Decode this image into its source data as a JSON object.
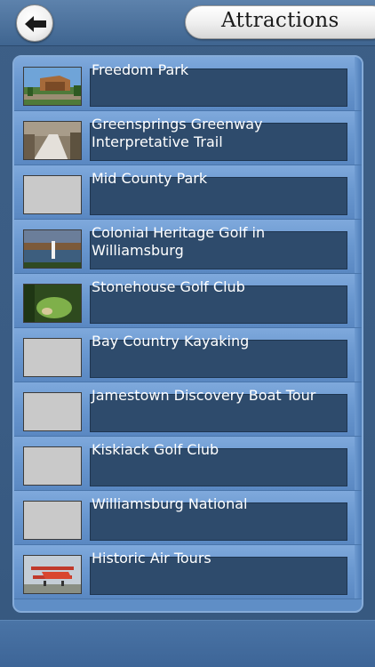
{
  "header": {
    "title": "Attractions",
    "back_icon": "left-arrow-icon"
  },
  "colors": {
    "background": "#3a5c84",
    "row_gradient_top": "#7fa9dc",
    "label_box": "#2e4b6c",
    "label_text": "#ffffff"
  },
  "list": {
    "items": [
      {
        "label": "Freedom Park",
        "thumbnail": "freedom-park-photo"
      },
      {
        "label": "Greensprings Greenway Interpretative Trail",
        "thumbnail": "greenway-trail-photo"
      },
      {
        "label": "Mid County Park",
        "thumbnail": "placeholder"
      },
      {
        "label": "Colonial Heritage Golf in Williamsburg",
        "thumbnail": "colonial-heritage-golf-photo"
      },
      {
        "label": "Stonehouse Golf Club",
        "thumbnail": "stonehouse-golf-photo"
      },
      {
        "label": "Bay Country Kayaking",
        "thumbnail": "placeholder"
      },
      {
        "label": "Jamestown Discovery Boat Tour",
        "thumbnail": "placeholder"
      },
      {
        "label": "Kiskiack Golf Club",
        "thumbnail": "placeholder"
      },
      {
        "label": "Williamsburg National",
        "thumbnail": "placeholder"
      },
      {
        "label": "Historic Air Tours",
        "thumbnail": "biplane-photo"
      }
    ]
  }
}
